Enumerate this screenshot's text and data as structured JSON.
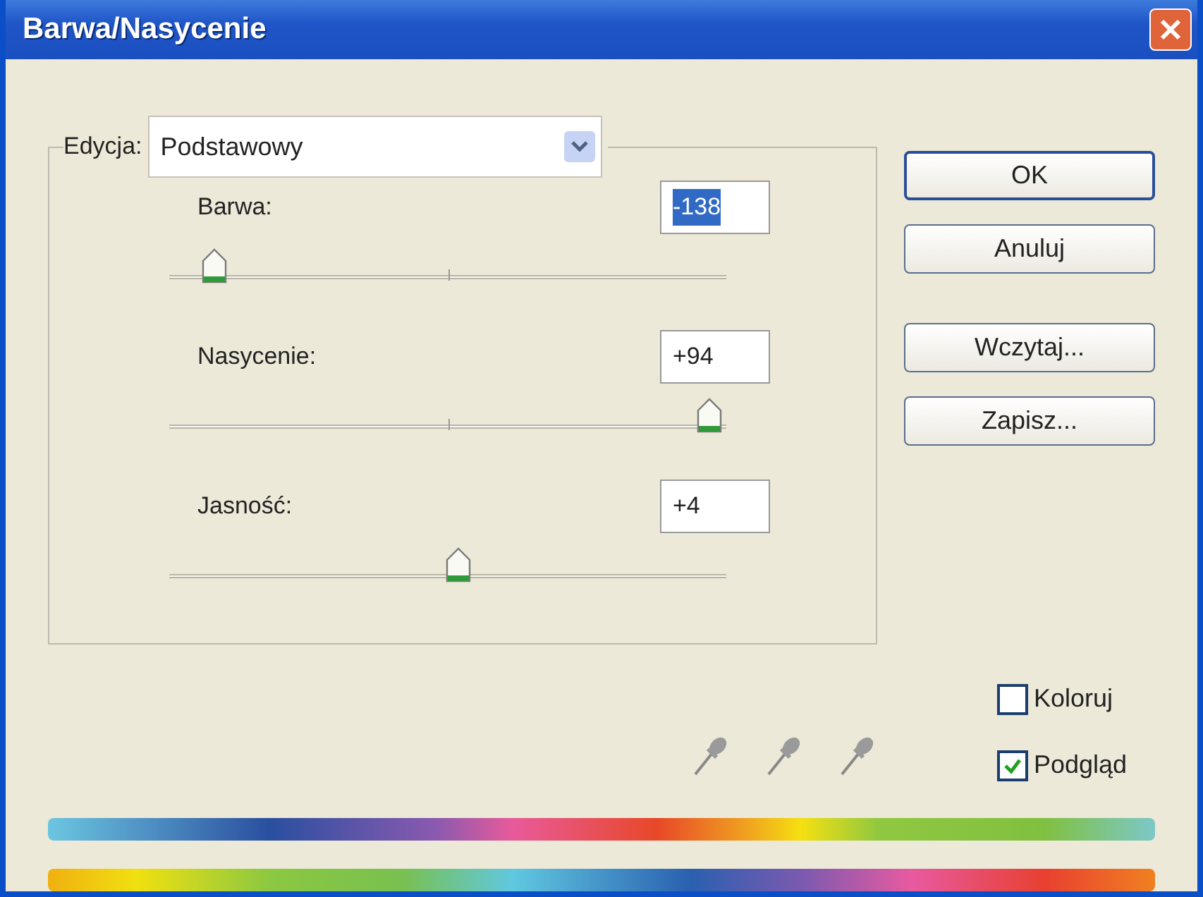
{
  "window": {
    "title": "Barwa/Nasycenie"
  },
  "edit": {
    "label": "Edycja:",
    "value": "Podstawowy"
  },
  "sliders": [
    {
      "label": "Barwa:",
      "value": "-138",
      "value_selected": true,
      "level": 0.08
    },
    {
      "label": "Nasycenie:",
      "value": "+94",
      "value_selected": false,
      "level": 0.97
    },
    {
      "label": "Jasność:",
      "value": "+4",
      "value_selected": false,
      "level": 0.52
    }
  ],
  "buttons": [
    {
      "label": "OK",
      "default": true
    },
    {
      "label": "Anuluj",
      "default": false
    },
    {
      "label": "Wczytaj...",
      "default": false
    },
    {
      "label": "Zapisz...",
      "default": false
    }
  ],
  "checkboxes": [
    {
      "label": "Koloruj",
      "checked": false
    },
    {
      "label": "Podgląd",
      "checked": true
    }
  ]
}
